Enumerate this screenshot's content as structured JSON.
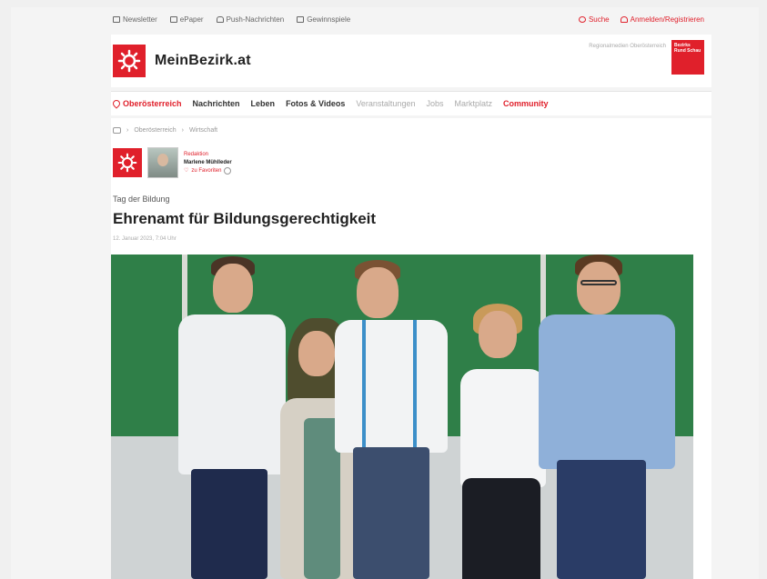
{
  "utility": {
    "left_items": [
      {
        "label": "Newsletter",
        "icon": "mail-icon"
      },
      {
        "label": "ePaper",
        "icon": "newspaper-icon"
      },
      {
        "label": "Push-Nachrichten",
        "icon": "bell-icon"
      },
      {
        "label": "Gewinnspiele",
        "icon": "gift-icon"
      }
    ],
    "search_label": "Suche",
    "login_label": "Anmelden/Registrieren"
  },
  "header": {
    "brand": "MeinBezirk.at",
    "note": "Regionalmedien Oberösterreich",
    "partner_logo_text": "Bezirks Rund Schau"
  },
  "nav": {
    "region": "Oberösterreich",
    "items": [
      {
        "label": "Nachrichten"
      },
      {
        "label": "Leben"
      },
      {
        "label": "Fotos & Videos"
      },
      {
        "label": "Veranstaltungen"
      },
      {
        "label": "Jobs"
      },
      {
        "label": "Marktplatz"
      },
      {
        "label": "Community"
      }
    ]
  },
  "breadcrumb": [
    "Oberösterreich",
    "Wirtschaft"
  ],
  "author": {
    "role": "Redaktion",
    "name": "Marlene Mühlleder",
    "favorite_label": "zu Favoriten"
  },
  "article": {
    "kicker": "Tag der Bildung",
    "title": "Ehrenamt für Bildungsgerechtigkeit",
    "date": "12. Januar 2023, 7:04 Uhr"
  },
  "colors": {
    "brand_red": "#e0202b",
    "chalkboard_green": "#2f7f48"
  }
}
